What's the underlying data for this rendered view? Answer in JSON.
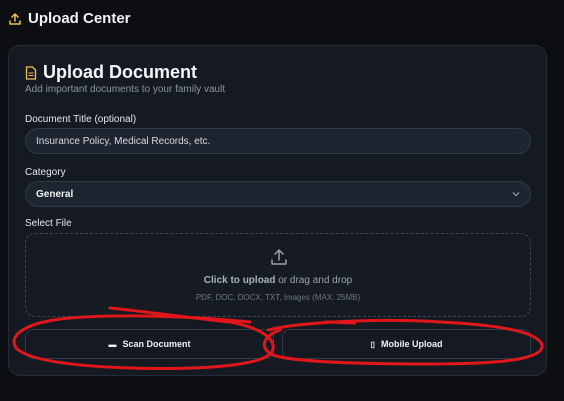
{
  "header": {
    "title": "Upload Center",
    "icon": "upload-icon"
  },
  "card": {
    "title": "Upload Document",
    "subtitle": "Add important documents to your family vault",
    "title_field": {
      "label": "Document Title (optional)",
      "placeholder": "Insurance Policy, Medical Records, etc."
    },
    "category": {
      "label": "Category",
      "value": "General"
    },
    "file": {
      "label": "Select File",
      "click_text": "Click to upload",
      "drag_text": " or drag and drop",
      "hint": "PDF, DOC, DOCX, TXT, Images (MAX. 25MB)"
    },
    "buttons": {
      "scan": "Scan Document",
      "mobile": "Mobile Upload"
    }
  },
  "colors": {
    "background": "#0c0e12",
    "card": "#151a22",
    "accent_icon": "#f2c14e",
    "annotation": "#e0161b"
  }
}
